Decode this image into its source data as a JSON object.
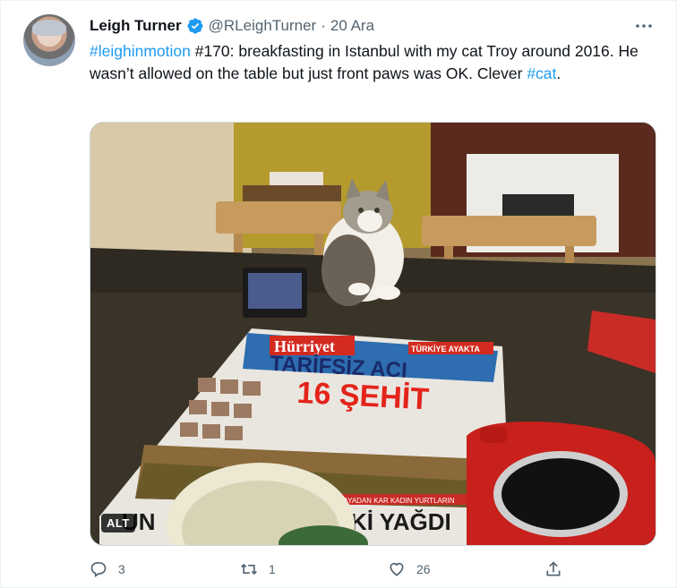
{
  "tweet": {
    "author_name": "Leigh Turner",
    "handle": "@RLeighTurner",
    "separator": "·",
    "date": "20 Ara",
    "text_parts": {
      "tag1": "#leighinmotion",
      "body": " #170: breakfasting in Istanbul with my cat Troy around 2016. He wasn’t allowed on the table but just front paws was OK. Clever ",
      "tag2": "#cat",
      "end": "."
    }
  },
  "media": {
    "alt_badge": "ALT",
    "newspaper_masthead": "Hürriyet",
    "newspaper_kicker": "TÜRKİYE AYAKTA",
    "headline_line1": "TARİFSİZ ACI",
    "headline_line2": "16 ŞEHİT",
    "bottom_headline": "Kİ YAĞDI",
    "bottom_fragment": "UN",
    "banner_text": "ŞEHİTLERİ HAYADAN KAR KADIN YURTLARIN"
  },
  "actions": {
    "reply_count": "3",
    "retweet_count": "1",
    "like_count": "26"
  },
  "colors": {
    "link": "#1d9bf0",
    "secondary": "#536471",
    "verified": "#1d9bf0"
  },
  "icons": [
    "verified-badge-icon",
    "more-icon",
    "reply-icon",
    "retweet-icon",
    "like-icon",
    "share-icon"
  ]
}
